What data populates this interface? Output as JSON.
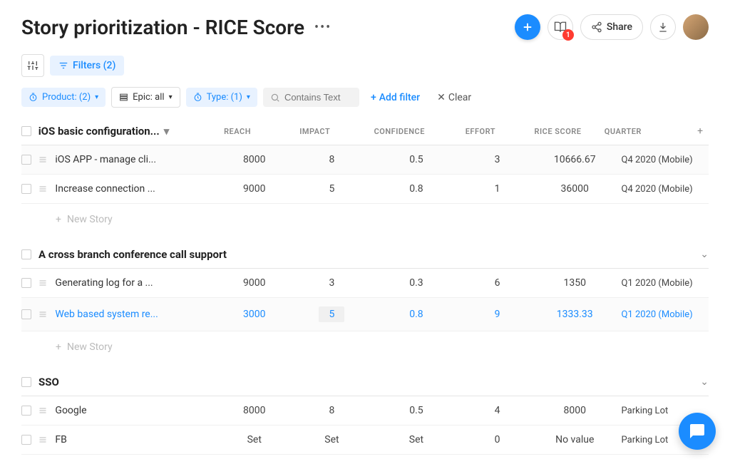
{
  "header": {
    "title": "Story prioritization - RICE Score",
    "share_label": "Share",
    "notification_count": "1"
  },
  "toolbar": {
    "filters_label": "Filters (2)"
  },
  "filters": {
    "product": "Product: (2)",
    "epic": "Epic: all",
    "type": "Type: (1)",
    "search_placeholder": "Contains Text",
    "add_filter": "Add filter",
    "clear": "Clear"
  },
  "columns": {
    "reach": "REACH",
    "impact": "IMPACT",
    "confidence": "CONFIDENCE",
    "effort": "EFFORT",
    "rice": "RICE SCORE",
    "quarter": "QUARTER"
  },
  "new_story_label": "New Story",
  "groups": [
    {
      "title": "iOS basic configuration...",
      "collapsed": false,
      "show_cols": true,
      "rows": [
        {
          "name": "iOS APP - manage cli...",
          "reach": "8000",
          "impact": "8",
          "confidence": "0.5",
          "effort": "3",
          "rice": "10666.67",
          "quarter": "Q4 2020 (Mobile)",
          "alt": true,
          "selected": false
        },
        {
          "name": "Increase connection ...",
          "reach": "9000",
          "impact": "5",
          "confidence": "0.8",
          "effort": "1",
          "rice": "36000",
          "quarter": "Q4 2020 (Mobile)",
          "alt": false,
          "selected": false
        }
      ]
    },
    {
      "title": "A cross branch conference call support",
      "collapsed": false,
      "show_cols": false,
      "rows": [
        {
          "name": "Generating log for a ...",
          "reach": "9000",
          "impact": "3",
          "confidence": "0.3",
          "effort": "6",
          "rice": "1350",
          "quarter": "Q1 2020 (Mobile)",
          "alt": false,
          "selected": false
        },
        {
          "name": "Web based system re...",
          "reach": "3000",
          "impact": "5",
          "confidence": "0.8",
          "effort": "9",
          "rice": "1333.33",
          "quarter": "Q1 2020 (Mobile)",
          "alt": true,
          "selected": true,
          "impact_box": true
        }
      ]
    },
    {
      "title": "SSO",
      "collapsed": false,
      "show_cols": false,
      "rows": [
        {
          "name": "Google",
          "reach": "8000",
          "impact": "8",
          "confidence": "0.5",
          "effort": "4",
          "rice": "8000",
          "quarter": "Parking Lot",
          "alt": false,
          "selected": false
        },
        {
          "name": "FB",
          "reach": "Set",
          "impact": "Set",
          "confidence": "Set",
          "effort": "0",
          "rice": "No value",
          "quarter": "Parking Lot",
          "alt": false,
          "selected": false
        }
      ]
    }
  ]
}
